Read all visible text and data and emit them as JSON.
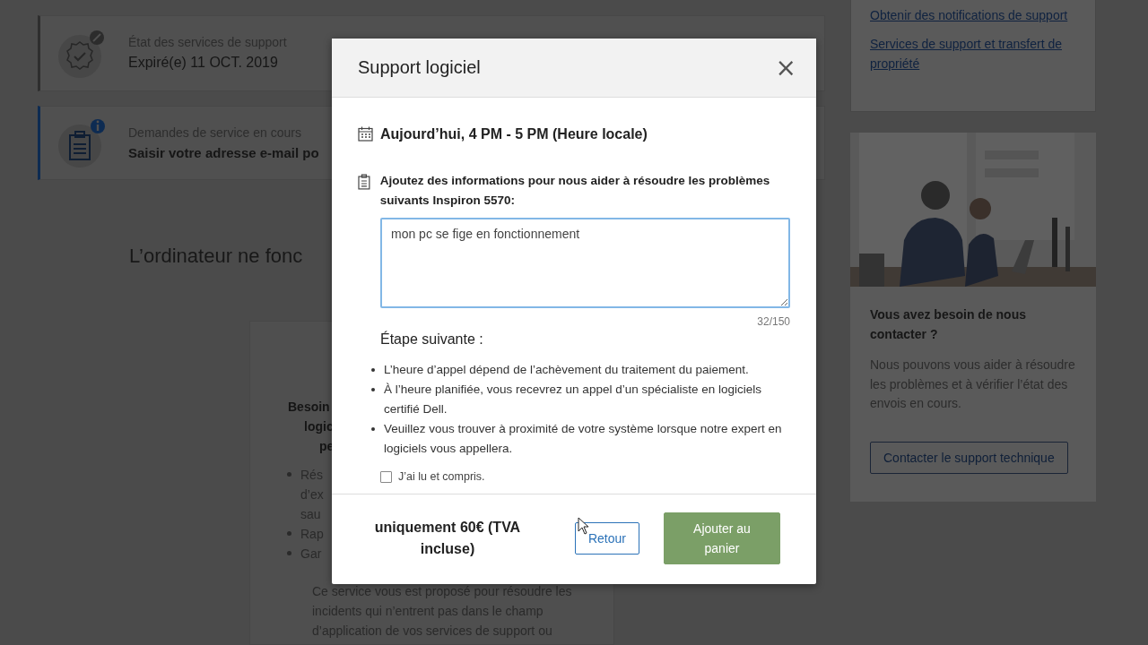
{
  "status_cards": [
    {
      "kind": "warranty",
      "color": "#2e2e2e",
      "label": "État des services de support",
      "value": "Expiré(e) 11 OCT. 2019"
    },
    {
      "kind": "requests",
      "color": "#0d2b52",
      "label": "Demandes de service en cours",
      "value": "Saisir votre adresse e-mail po"
    }
  ],
  "section_heading": "L’ordinateur ne fonc",
  "offer_card": {
    "title_lines": [
      "Besoin",
      "logic",
      "pe"
    ],
    "bullets": [
      "Rés",
      "d’ex",
      "sau",
      "Rap",
      "Gar"
    ],
    "description_lines": [
      "Ce service vous est proposé pour résoudre les",
      "incidents qui n’entrent pas dans le champ",
      "d’application de vos services de support ou"
    ]
  },
  "sidebar": {
    "links": [
      "Obtenir des notifications de support",
      "Services de support et transfert de propriété"
    ],
    "contact": {
      "title": "Vous avez besoin de nous contacter ?",
      "text": "Nous pouvons vous aider à résoudre les problèmes et à vérifier l’état des envois en cours.",
      "button": "Contacter le support technique"
    }
  },
  "dialog": {
    "title": "Support logiciel",
    "close": "×",
    "schedule": "Aujourd’hui, 4 PM - 5 PM (Heure locale)",
    "prompt": "Ajoutez des informations pour nous aider à résoudre les problèmes suivants Inspiron 5570:",
    "description": {
      "value": "mon pc se fige en fonctionnement",
      "counter": "32/150",
      "focused": true
    },
    "next_step": {
      "title": "Étape suivante :",
      "items": [
        "L’heure d’appel dépend de l’achèvement du traitement du paiement.",
        " À l’heure planifiée, vous recevrez un appel d’un spécialiste en logiciels certifié Dell.",
        " Veuillez vous trouver à proximité de votre système lorsque notre expert en logiciels vous appellera."
      ]
    },
    "acknowledge": {
      "label": "J’ai lu et compris.",
      "checked": false
    },
    "price": "uniquement 60€ (TVA incluse)",
    "buttons": [
      {
        "kind": "secondary",
        "label": "Retour",
        "disabled": false
      },
      {
        "kind": "primary",
        "label": "Ajouter au panier",
        "disabled": true
      }
    ]
  }
}
